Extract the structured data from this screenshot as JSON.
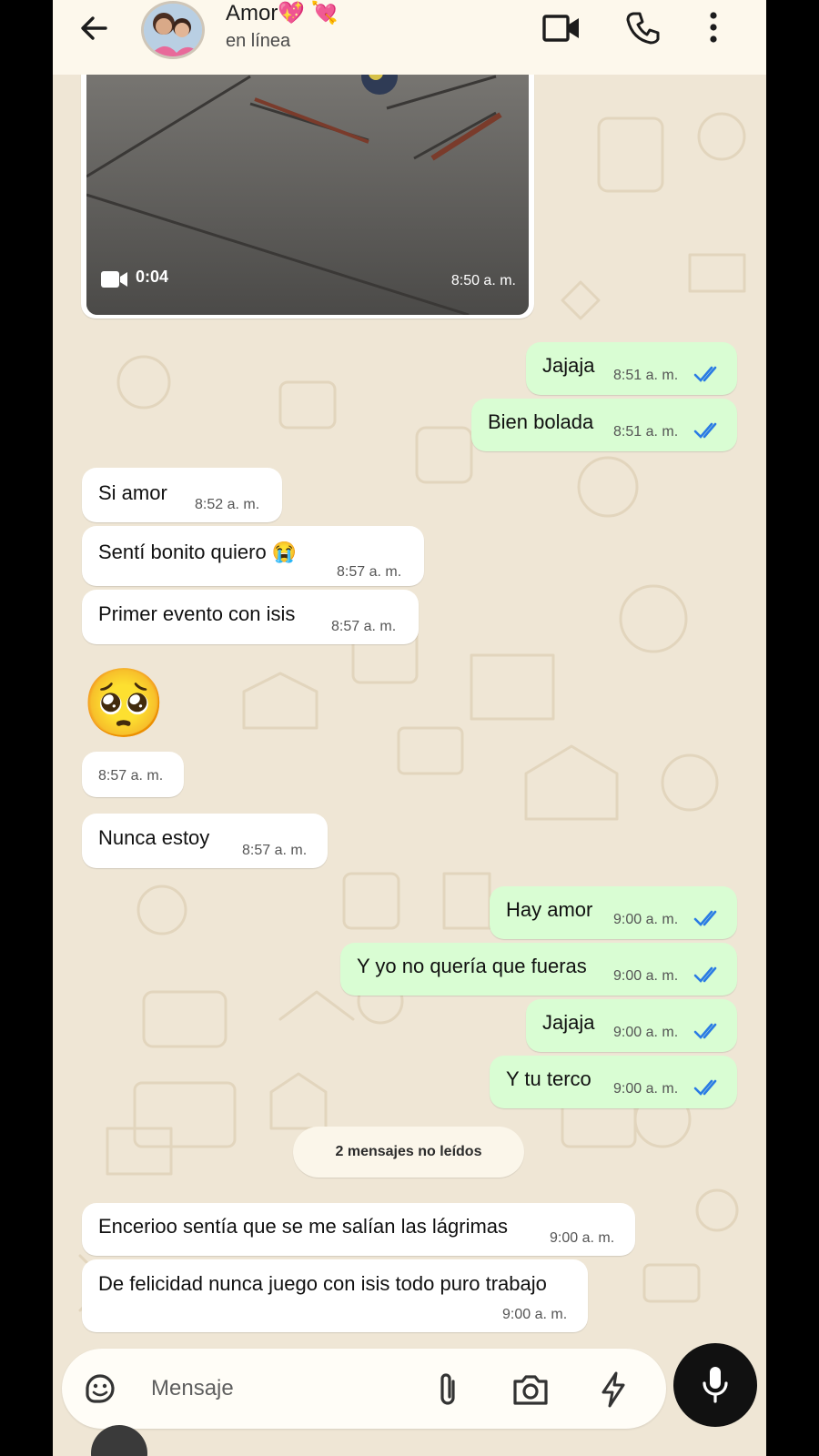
{
  "header": {
    "contact_name": "Amor💖 💘",
    "status": "en línea"
  },
  "video": {
    "duration": "0:04",
    "time": "8:50 a. m."
  },
  "messages": [
    {
      "dir": "out",
      "text": "Jajaja",
      "time": "8:51 a. m.",
      "ticks": "read"
    },
    {
      "dir": "out",
      "text": "Bien bolada",
      "time": "8:51 a. m.",
      "ticks": "read"
    },
    {
      "dir": "in",
      "text": "Si amor",
      "time": "8:52 a. m."
    },
    {
      "dir": "in",
      "text": "Sentí bonito quiero 😭",
      "time": "8:57 a. m."
    },
    {
      "dir": "in",
      "text": "Primer evento con isis",
      "time": "8:57 a. m."
    },
    {
      "dir": "in",
      "text": "🥺",
      "time": "8:57 a. m."
    },
    {
      "dir": "in",
      "text": "Nunca estoy",
      "time": "8:57 a. m."
    },
    {
      "dir": "out",
      "text": "Hay amor",
      "time": "9:00 a. m.",
      "ticks": "read"
    },
    {
      "dir": "out",
      "text": "Y yo no quería que fueras",
      "time": "9:00 a. m.",
      "ticks": "read"
    },
    {
      "dir": "out",
      "text": "Jajaja",
      "time": "9:00 a. m.",
      "ticks": "read"
    },
    {
      "dir": "out",
      "text": "Y tu terco",
      "time": "9:00 a. m.",
      "ticks": "read"
    },
    {
      "dir": "in",
      "text": "Encerioo sentía que se me salían las lágrimas",
      "time": "9:00 a. m."
    },
    {
      "dir": "in",
      "text": "De felicidad nunca juego con isis todo puro trabajo",
      "time": "9:00 a. m."
    }
  ],
  "unread_banner": "2 mensajes no leídos",
  "composer": {
    "placeholder": "Mensaje"
  },
  "colors": {
    "outgoing_bubble": "#d9fdd3",
    "incoming_bubble": "#ffffff",
    "read_ticks": "#2a7be4",
    "wallpaper": "#efe6d5"
  },
  "icons": [
    "back-arrow-icon",
    "video-call-icon",
    "phone-icon",
    "more-options-icon",
    "video-camera-icon",
    "double-check-icon",
    "sticker-icon",
    "attach-icon",
    "camera-icon",
    "lightning-icon",
    "mic-icon"
  ]
}
